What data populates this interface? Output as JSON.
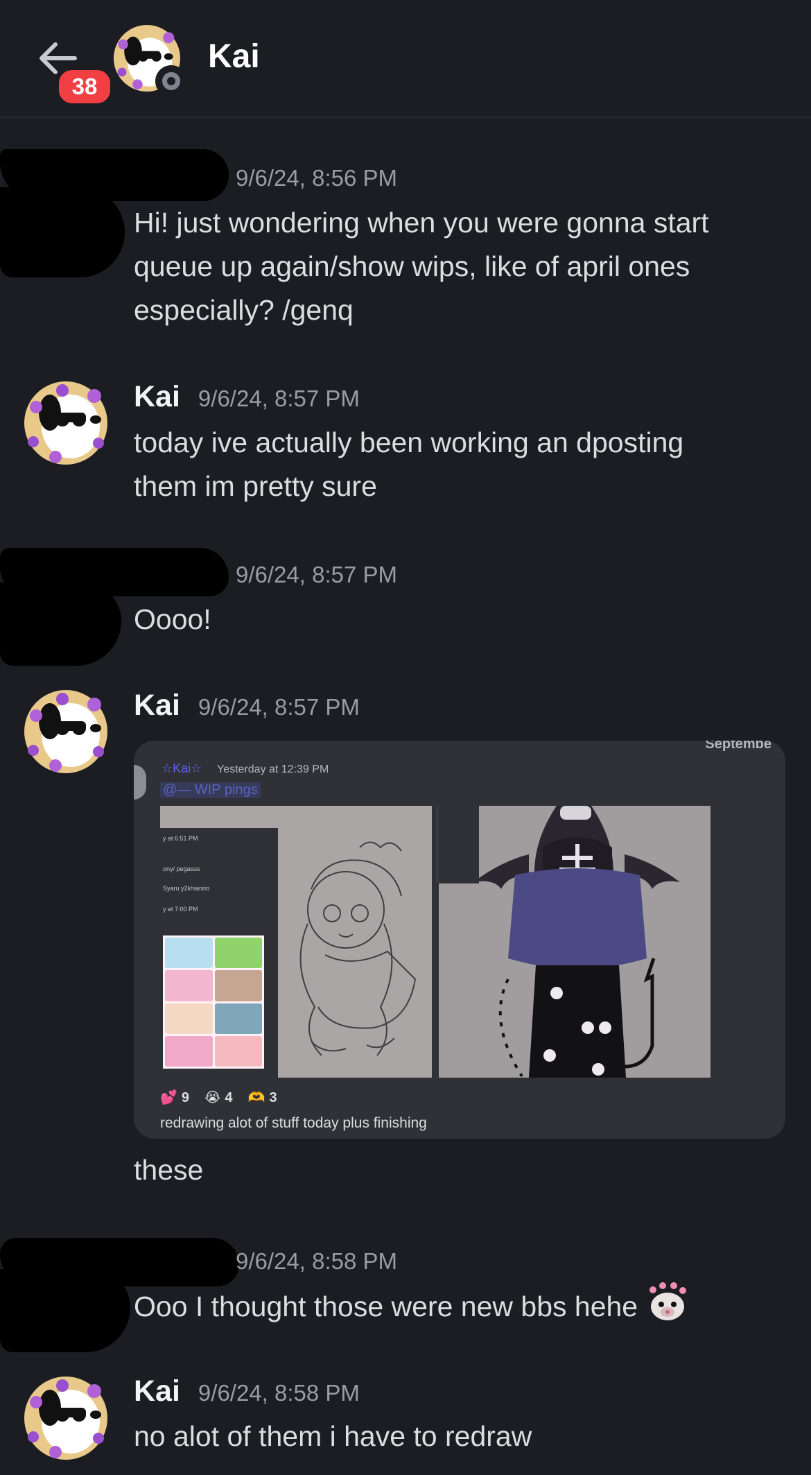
{
  "header": {
    "title": "Kai",
    "unread_badge": "38",
    "back_icon": "arrow-left-icon",
    "status": "offline"
  },
  "messages": [
    {
      "author": "",
      "timestamp": "9/6/24, 8:56 PM",
      "lines": [
        "Hi! just wondering when you were gonna start",
        "queue up again/show wips, like of april ones",
        "especially? /genq"
      ]
    },
    {
      "author": "Kai",
      "timestamp": "9/6/24, 8:57 PM",
      "lines": [
        "today ive actually been working an dposting",
        "them im pretty sure"
      ]
    },
    {
      "author": "",
      "timestamp": "9/6/24, 8:57 PM",
      "lines": [
        "Oooo!"
      ]
    },
    {
      "author": "Kai",
      "timestamp": "9/6/24, 8:57 PM",
      "lines": [
        "these"
      ]
    },
    {
      "author": "",
      "timestamp": "9/6/24, 8:58 PM",
      "lines": [
        "Ooo I thought those were new bbs hehe"
      ]
    },
    {
      "author": "Kai",
      "timestamp": "9/6/24, 8:58 PM",
      "lines": [
        "no alot of them i have to redraw"
      ]
    }
  ],
  "embed": {
    "corner_text": "Septembe",
    "author": "☆Kai☆",
    "timestamp": "Yesterday at 12:39 PM",
    "mention": "@— WIP pings",
    "left_panel_lines": [
      "y at 6:51 PM",
      "ony/ pegasus",
      "Syaru y2k/sanrio",
      "y at 7:00 PM"
    ],
    "reactions": [
      {
        "icon": "hearts-icon",
        "count": "9"
      },
      {
        "icon": "crying-face-icon",
        "count": "4"
      },
      {
        "icon": "heart-hands-icon",
        "count": "3"
      }
    ],
    "caption": "redrawing alot of stuff today plus finishing"
  },
  "colors": {
    "background": "#1c1d22",
    "badge": "#f23f43",
    "embed_bg": "#303136",
    "mention": "#5865f2"
  }
}
